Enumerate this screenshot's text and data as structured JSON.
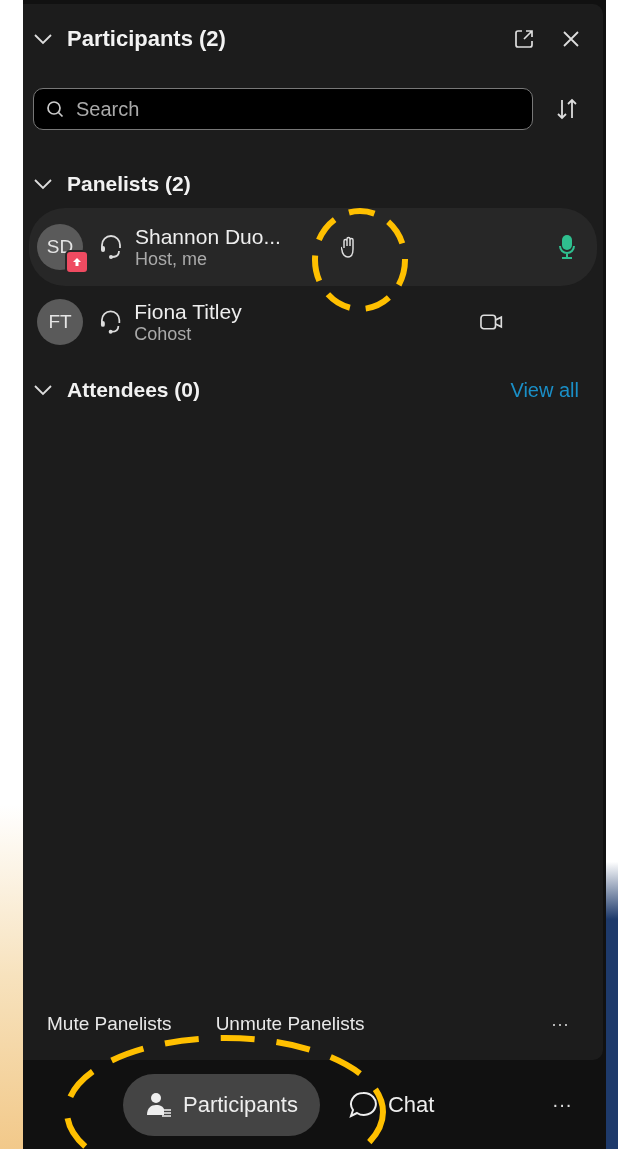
{
  "panel": {
    "title": "Participants (2)",
    "search": {
      "placeholder": "Search"
    }
  },
  "groups": [
    {
      "title": "Panelists (2)",
      "members": [
        {
          "initials": "SD",
          "name": "Shannon Duo...",
          "role": "Host, me",
          "sharing": true,
          "selected": true,
          "hand_raised": true,
          "kind": "mic"
        },
        {
          "initials": "FT",
          "name": "Fiona Titley",
          "role": "Cohost",
          "sharing": false,
          "selected": false,
          "hand_raised": false,
          "kind": "video"
        }
      ]
    },
    {
      "title": "Attendees (0)",
      "link": "View all"
    }
  ],
  "actions": [
    "Mute Panelists",
    "Unmute Panelists"
  ],
  "actions_more": "···",
  "tabs": [
    {
      "kind": "participants",
      "label": "Participants",
      "selected": true
    },
    {
      "kind": "chat",
      "label": "Chat",
      "selected": false
    }
  ],
  "tabs_more": "···"
}
